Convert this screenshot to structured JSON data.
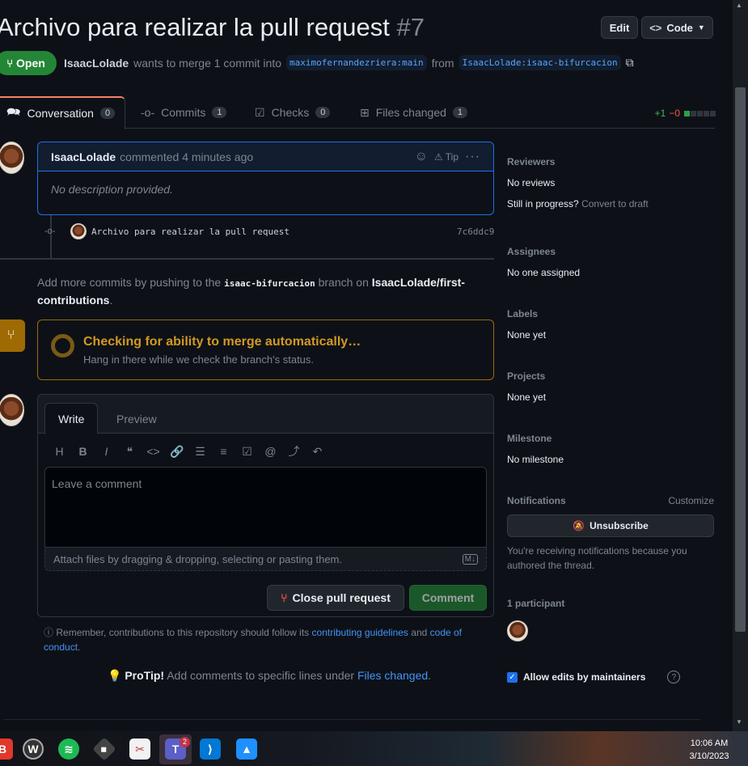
{
  "header": {
    "title": "Archivo para realizar la pull request",
    "number": "#7",
    "edit_label": "Edit",
    "code_label": "Code",
    "state_label": "Open",
    "author": "IsaacLolade",
    "merge_text": "wants to merge 1 commit into",
    "base_branch": "maximofernandezriera:main",
    "from_text": "from",
    "head_branch": "IsaacLolade:isaac-bifurcacion"
  },
  "tabs": [
    {
      "label": "Conversation",
      "count": "0"
    },
    {
      "label": "Commits",
      "count": "1"
    },
    {
      "label": "Checks",
      "count": "0"
    },
    {
      "label": "Files changed",
      "count": "1"
    }
  ],
  "diffstat": {
    "additions": "+1",
    "deletions": "−0"
  },
  "comment": {
    "author": "IsaacLolade",
    "action": "commented 4 minutes ago",
    "tip": "Tip",
    "body": "No description provided."
  },
  "commit": {
    "message": "Archivo para realizar la pull request",
    "sha": "7c6ddc9"
  },
  "push_hint": {
    "prefix": "Add more commits by pushing to the",
    "branch": "isaac-bifurcacion",
    "mid": "branch on",
    "repo": "IsaacLolade/first-contributions",
    "suffix": "."
  },
  "merge_check": {
    "title": "Checking for ability to merge automatically…",
    "subtitle": "Hang in there while we check the branch's status."
  },
  "editor": {
    "write_tab": "Write",
    "preview_tab": "Preview",
    "placeholder": "Leave a comment",
    "attach_text": "Attach files by dragging & dropping, selecting or pasting them.",
    "close_label": "Close pull request",
    "comment_label": "Comment"
  },
  "footer": {
    "remember_prefix": "Remember, contributions to this repository should follow its",
    "guidelines_link": "contributing guidelines",
    "and": "and",
    "conduct_link": "code of conduct",
    "period": ".",
    "protip_label": "ProTip!",
    "protip_text": "Add comments to specific lines under",
    "protip_link": "Files changed",
    "protip_end": "."
  },
  "sidebar": {
    "reviewers_label": "Reviewers",
    "reviewers_value": "No reviews",
    "in_progress": "Still in progress?",
    "convert_draft": "Convert to draft",
    "assignees_label": "Assignees",
    "assignees_value": "No one assigned",
    "labels_label": "Labels",
    "labels_value": "None yet",
    "projects_label": "Projects",
    "projects_value": "None yet",
    "milestone_label": "Milestone",
    "milestone_value": "No milestone",
    "notifications_label": "Notifications",
    "customize_label": "Customize",
    "unsubscribe_label": "Unsubscribe",
    "notifications_reason": "You're receiving notifications because you authored the thread.",
    "participants_label": "1 participant",
    "allow_edits_label": "Allow edits by maintainers"
  },
  "taskbar": {
    "time": "10:06 AM",
    "date": "3/10/2023",
    "teams_badge": "2"
  },
  "colors": {
    "accent_green": "#238636",
    "link_blue": "#4493f8",
    "warning": "#d29922"
  }
}
